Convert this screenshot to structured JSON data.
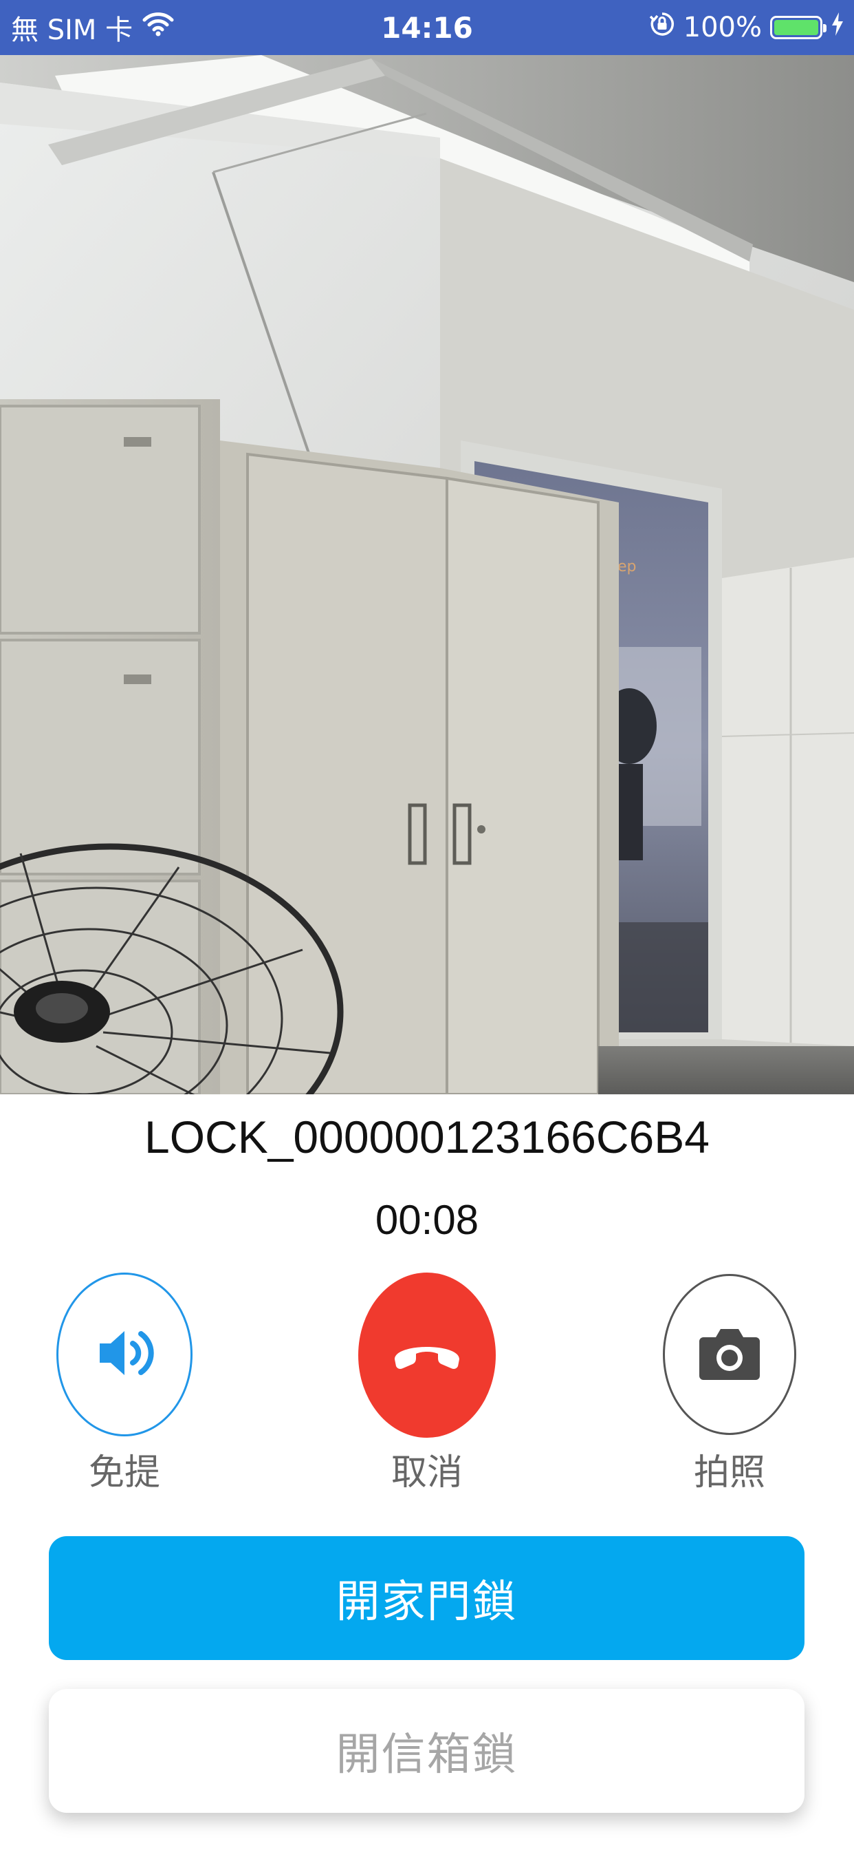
{
  "status_bar": {
    "carrier": "無 SIM 卡",
    "time": "14:16",
    "battery": "100%",
    "icons": [
      "wifi-icon",
      "rotation-lock-icon",
      "battery-icon",
      "charging-bolt-icon"
    ],
    "battery_level": 1.0,
    "background_color": "#3f62c0"
  },
  "video": {
    "overlay_text": "ing Dep"
  },
  "call": {
    "device_name": "LOCK_000000123166C6B4",
    "duration": "00:08"
  },
  "actions": {
    "speaker_label": "免提",
    "cancel_label": "取消",
    "photo_label": "拍照",
    "speaker_icon": "speaker-volume-icon",
    "cancel_icon": "phone-hangup-icon",
    "photo_icon": "camera-icon",
    "colors": {
      "speaker": "#2196e8",
      "hangup": "#f03a2e",
      "camera": "#555555"
    }
  },
  "unlock": {
    "home_label": "開家門鎖",
    "mailbox_label": "開信箱鎖",
    "home_color": "#04a8ef"
  }
}
